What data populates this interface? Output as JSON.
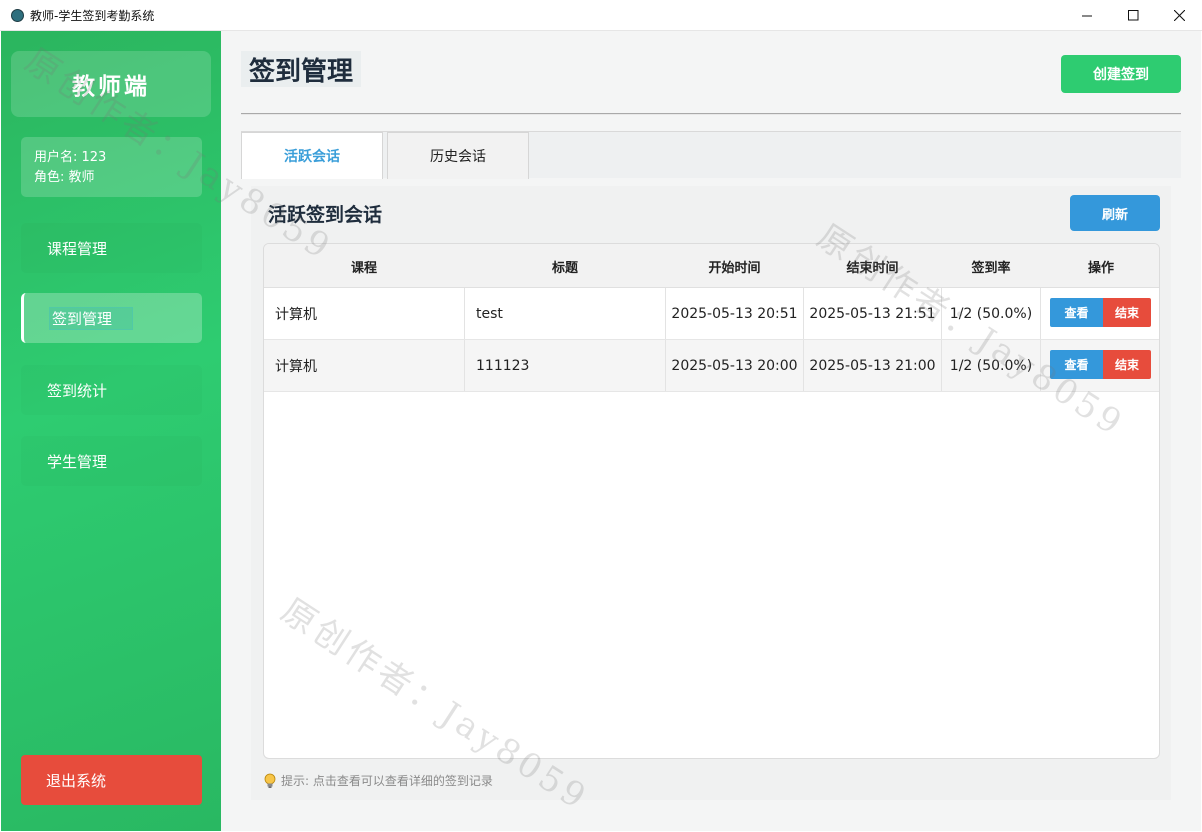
{
  "window": {
    "title": "教师-学生签到考勤系统"
  },
  "sidebar": {
    "brand": "教师端",
    "user": {
      "username_line": "用户名: 123",
      "role_line": "角色: 教师"
    },
    "items": [
      {
        "label": "课程管理",
        "active": false
      },
      {
        "label": "签到管理",
        "active": true
      },
      {
        "label": "签到统计",
        "active": false
      },
      {
        "label": "学生管理",
        "active": false
      }
    ],
    "logout_label": "退出系统"
  },
  "header": {
    "title": "签到管理",
    "create_button": "创建签到"
  },
  "tabs": [
    {
      "label": "活跃会话",
      "active": true
    },
    {
      "label": "历史会话",
      "active": false
    }
  ],
  "panel": {
    "title": "活跃签到会话",
    "refresh_button": "刷新",
    "table": {
      "columns": [
        "课程",
        "标题",
        "开始时间",
        "结束时间",
        "签到率",
        "操作"
      ],
      "rows": [
        {
          "course": "计算机",
          "title": "test",
          "start": "2025-05-13 20:51",
          "end": "2025-05-13 21:51",
          "rate": "1/2 (50.0%)",
          "view": "查看",
          "end_action": "结束"
        },
        {
          "course": "计算机",
          "title": "111123",
          "start": "2025-05-13 20:00",
          "end": "2025-05-13 21:00",
          "rate": "1/2 (50.0%)",
          "view": "查看",
          "end_action": "结束"
        }
      ]
    },
    "hint": "提示: 点击查看可以查看详细的签到记录"
  },
  "watermark": {
    "text": "原创作者：Jay8059"
  },
  "colors": {
    "sidebar_green": "#2ecc71",
    "create_green": "#2ecc71",
    "primary_blue": "#3498db",
    "danger_red": "#e74c3c",
    "active_tab_text": "#3a9ed9"
  },
  "icons": {
    "app": "app-icon",
    "minimize": "minimize-icon",
    "maximize": "maximize-icon",
    "close": "close-icon",
    "hint": "lightbulb-icon"
  }
}
